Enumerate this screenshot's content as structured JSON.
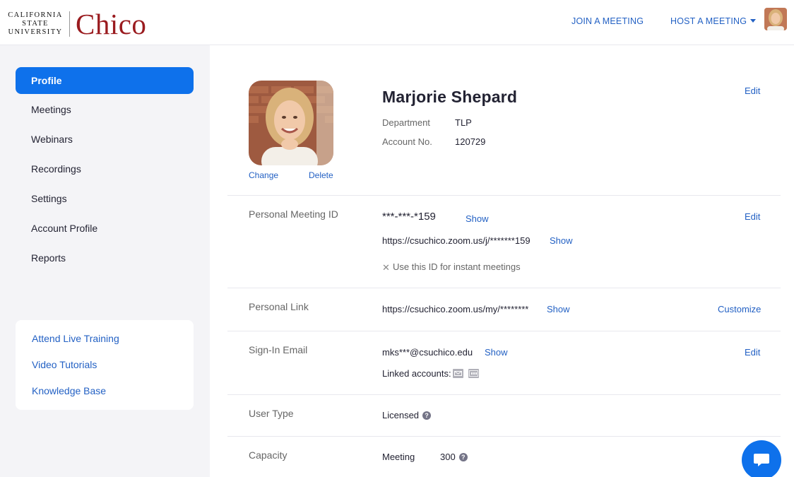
{
  "header": {
    "logo_small_line1": "CALIFORNIA",
    "logo_small_line2": "STATE",
    "logo_small_line3": "UNIVERSITY",
    "logo_big": "Chico",
    "join_meeting": "JOIN A MEETING",
    "host_meeting": "HOST A MEETING"
  },
  "sidebar": {
    "items": [
      {
        "label": "Profile"
      },
      {
        "label": "Meetings"
      },
      {
        "label": "Webinars"
      },
      {
        "label": "Recordings"
      },
      {
        "label": "Settings"
      },
      {
        "label": "Account Profile"
      },
      {
        "label": "Reports"
      }
    ],
    "help": [
      {
        "label": "Attend Live Training"
      },
      {
        "label": "Video Tutorials"
      },
      {
        "label": "Knowledge Base"
      }
    ]
  },
  "profile": {
    "change": "Change",
    "delete": "Delete",
    "name": "Marjorie Shepard",
    "edit": "Edit",
    "department_label": "Department",
    "department_value": "TLP",
    "account_label": "Account No.",
    "account_value": "120729"
  },
  "pmi": {
    "label": "Personal Meeting ID",
    "masked_id": "***-***-*159",
    "show": "Show",
    "edit": "Edit",
    "url": "https://csuchico.zoom.us/j/*******159",
    "url_show": "Show",
    "instant": "Use this ID for instant meetings"
  },
  "personal_link": {
    "label": "Personal Link",
    "url": "https://csuchico.zoom.us/my/********",
    "show": "Show",
    "customize": "Customize"
  },
  "email": {
    "label": "Sign-In Email",
    "value": "mks***@csuchico.edu",
    "show": "Show",
    "edit": "Edit",
    "linked": "Linked accounts:"
  },
  "user_type": {
    "label": "User Type",
    "value": "Licensed"
  },
  "capacity": {
    "label": "Capacity",
    "meeting_label": "Meeting",
    "meeting_value": "300"
  },
  "colors": {
    "accent": "#0e71eb",
    "link": "#2361c4",
    "brand": "#9a1b1f"
  }
}
